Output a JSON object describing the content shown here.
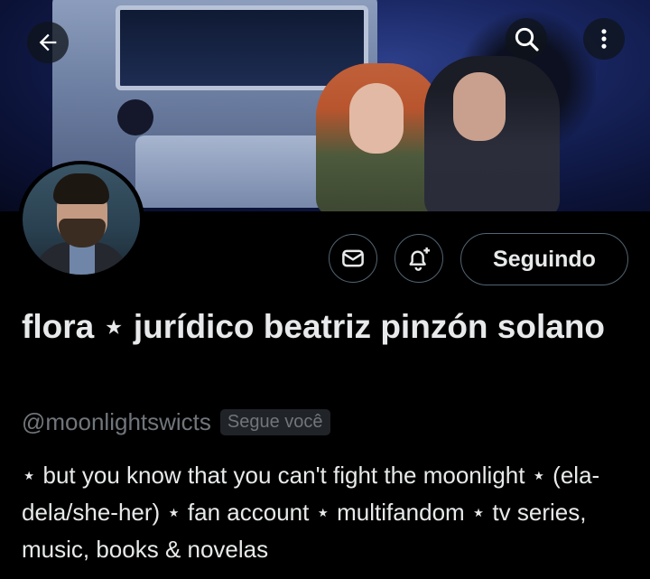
{
  "header": {
    "back_icon": "arrow-left-icon",
    "search_icon": "search-icon",
    "more_icon": "more-vertical-icon"
  },
  "profile": {
    "display_name": "flora ⋆ jurídico beatriz pinzón solano",
    "handle": "@moonlightswicts",
    "follows_you_badge": "Segue você",
    "bio": "⋆ but you know that you can't fight the moonlight ⋆ (ela-dela/she-her) ⋆ fan account ⋆ multifandom ⋆ tv series, music, books & novelas"
  },
  "actions": {
    "message_icon": "envelope-icon",
    "notify_icon": "bell-plus-icon",
    "following_label": "Seguindo"
  },
  "colors": {
    "background": "#000000",
    "text_primary": "#e7e9ea",
    "text_secondary": "#71767b",
    "border": "#536471"
  }
}
